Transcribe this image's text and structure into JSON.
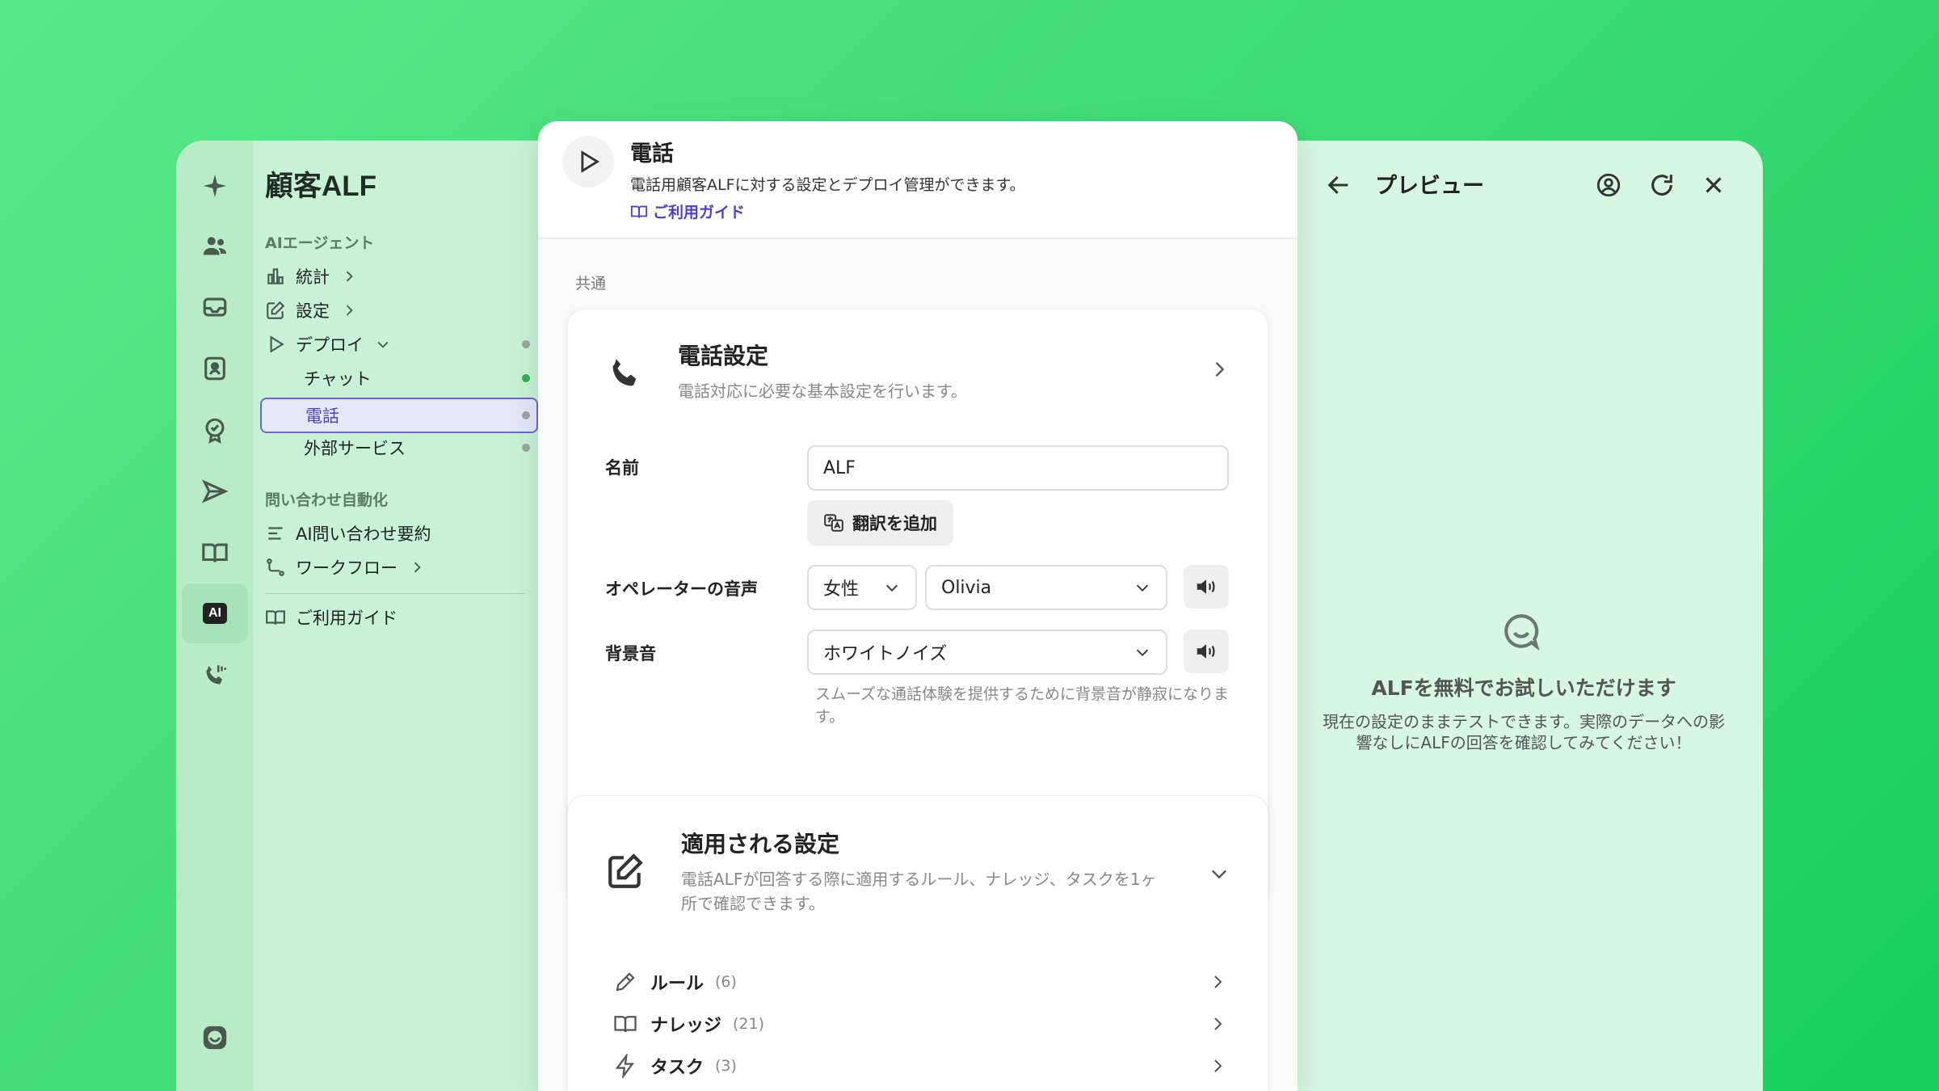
{
  "sidebar": {
    "title": "顧客ALF",
    "section_ai": "AIエージェント",
    "items": [
      {
        "label": "統計"
      },
      {
        "label": "設定"
      },
      {
        "label": "デプロイ"
      },
      {
        "label": "チャット"
      },
      {
        "label": "電話"
      },
      {
        "label": "外部サービス"
      }
    ],
    "section_automation": "問い合わせ自動化",
    "automation_items": [
      {
        "label": "AI問い合わせ要約"
      },
      {
        "label": "ワークフロー"
      }
    ],
    "guide_label": "ご利用ガイド",
    "rail_active": "AI"
  },
  "header": {
    "title": "電話",
    "description": "電話用顧客ALFに対する設定とデプロイ管理ができます。",
    "guide_link": "ご利用ガイド"
  },
  "main": {
    "section_label": "共通",
    "phone_settings": {
      "title": "電話設定",
      "description": "電話対応に必要な基本設定を行います。",
      "name_label": "名前",
      "name_value": "ALF",
      "translate_button": "翻訳を追加",
      "voice_label": "オペレーターの音声",
      "voice_gender": "女性",
      "voice_name": "Olivia",
      "bg_label": "背景音",
      "bg_value": "ホワイトノイズ",
      "bg_help": "スムーズな通話体験を提供するために背景音が静寂になります。"
    },
    "applied_settings": {
      "title": "適用される設定",
      "description": "電話ALFが回答する際に適用するルール、ナレッジ、タスクを1ヶ所で確認できます。",
      "rows": [
        {
          "label": "ルール",
          "count": "(6)"
        },
        {
          "label": "ナレッジ",
          "count": "(21)"
        },
        {
          "label": "タスク",
          "count": "(3)"
        }
      ]
    }
  },
  "preview": {
    "title": "プレビュー",
    "empty_title": "ALFを無料でお試しいただけます",
    "empty_description": "現在の設定のままテストできます。実際のデータへの影響なしにALFの回答を確認してみてください！"
  },
  "colors": {
    "accent": "#4b3fd8",
    "status_green": "#2bb55a",
    "status_grey": "#9aa89e"
  }
}
